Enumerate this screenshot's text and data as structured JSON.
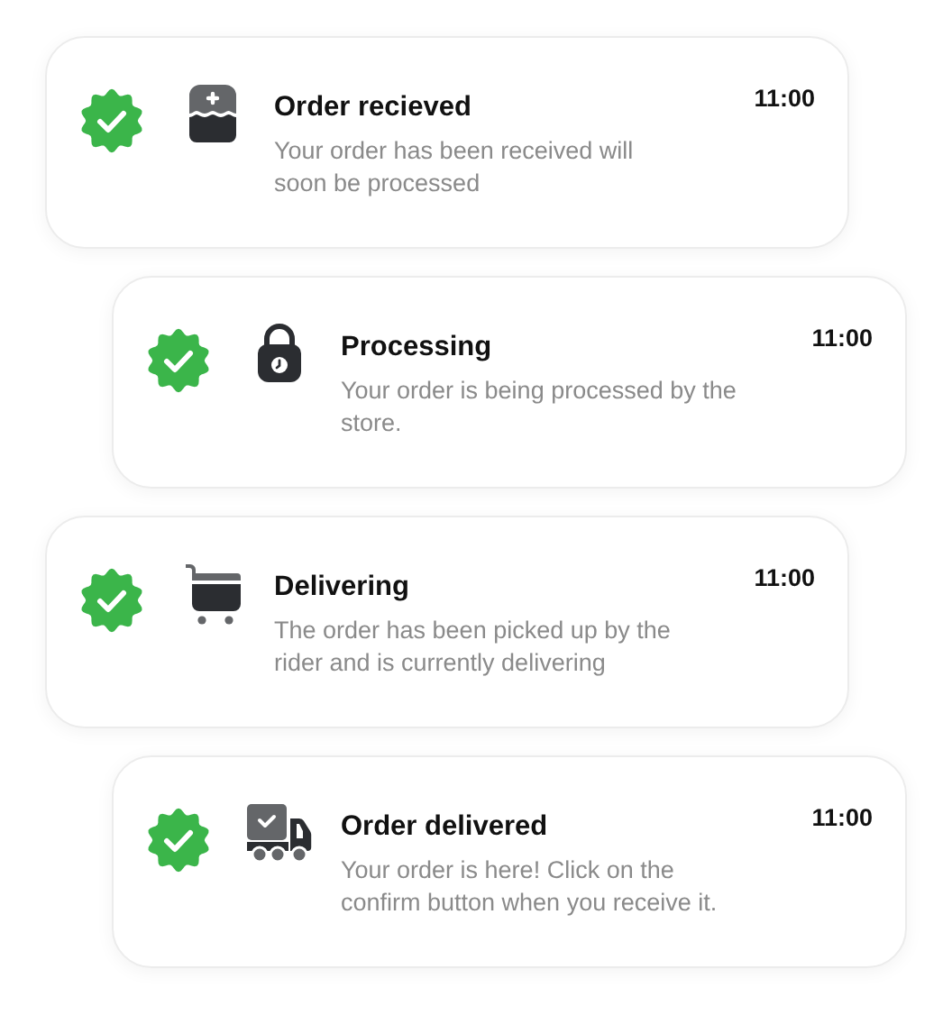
{
  "steps": [
    {
      "kind": "box",
      "title": "Order recieved",
      "description": "Your order has been received will soon be processed",
      "time": "11:00",
      "completed": true
    },
    {
      "kind": "bag",
      "title": "Processing",
      "description": "Your order is being processed by the store.",
      "time": "11:00",
      "completed": true
    },
    {
      "kind": "cart",
      "title": "Delivering",
      "description": "The order has been picked up by the rider and is currently delivering",
      "time": "11:00",
      "completed": true
    },
    {
      "kind": "truck",
      "title": "Order delivered",
      "description": "Your order is here! Click on the confirm button when you receive it.",
      "time": "11:00",
      "completed": true
    }
  ]
}
